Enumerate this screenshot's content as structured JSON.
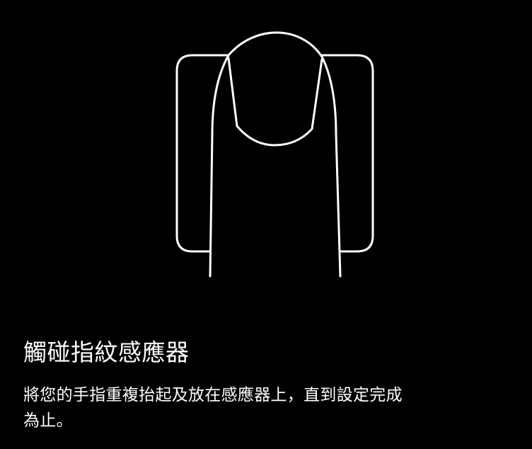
{
  "screen": {
    "background_color": "#000000",
    "foreground_color": "#FFFFFF",
    "illustration_icon": "finger-on-sensor-icon",
    "title": "觸碰指紋感應器",
    "description": "將您的手指重複抬起及放在感應器上，直到設定完成為止。"
  }
}
